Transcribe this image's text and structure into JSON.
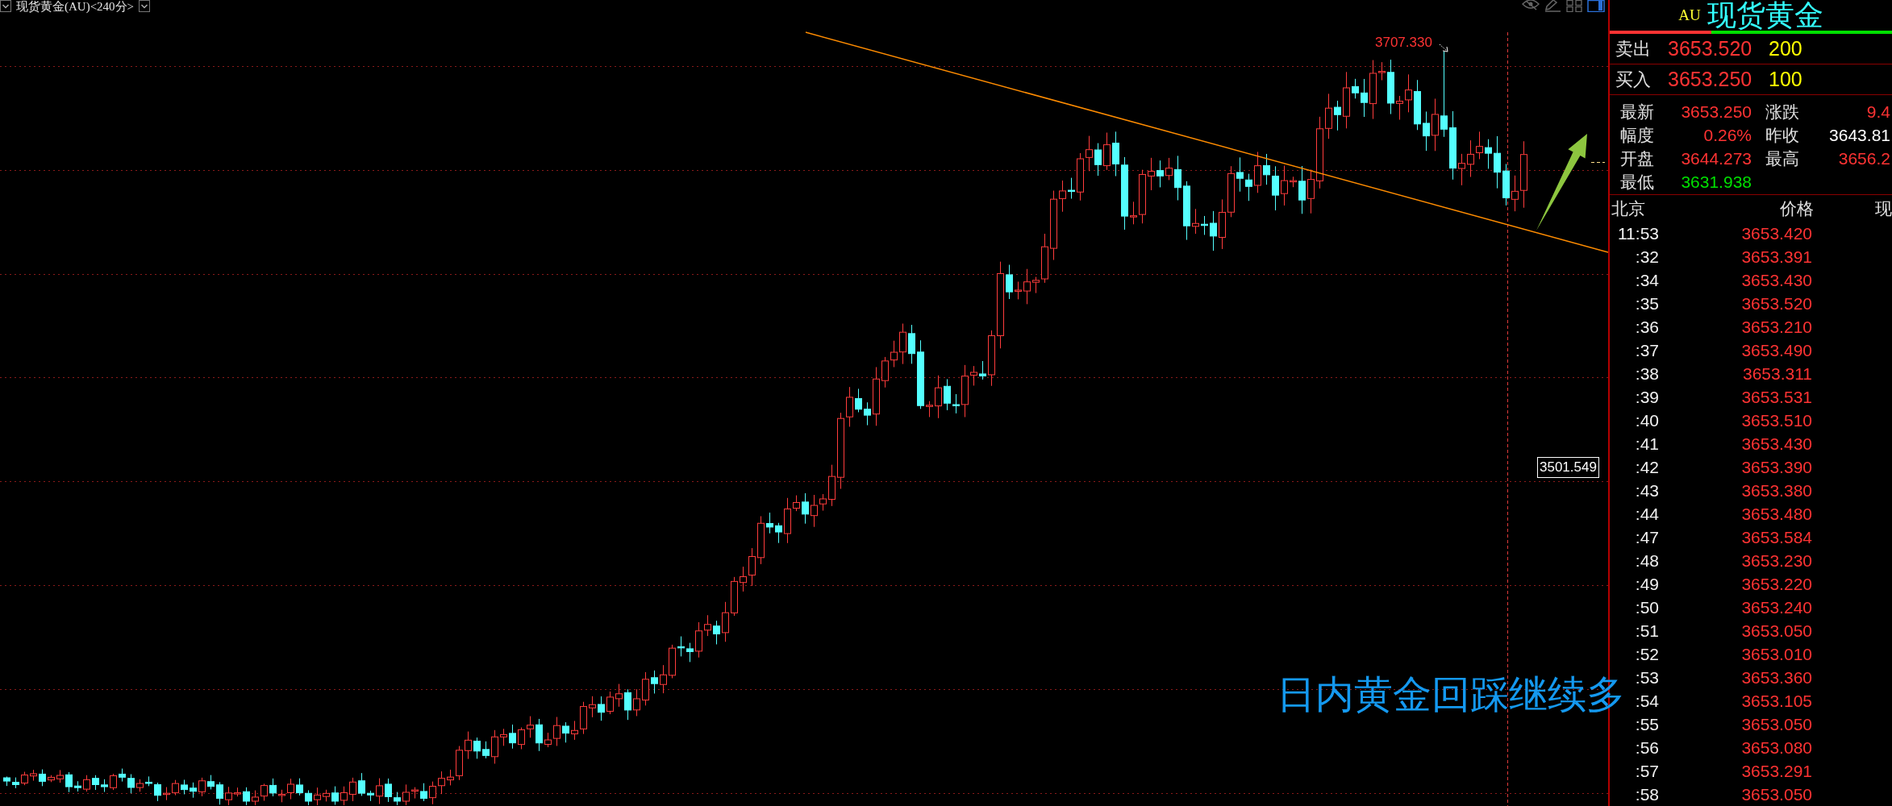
{
  "toolbar": {
    "title": "现货黄金(AU)<240分>"
  },
  "chart": {
    "high_label": "3707.330",
    "price_label": "3501.549",
    "annotation": "日内黄金回踩继续多"
  },
  "quote_panel": {
    "code": "AU",
    "name": "现货黄金",
    "buy_sell_bar": {
      "level": 0.36
    },
    "orders": [
      {
        "label": "卖出",
        "price": "3653.520",
        "volume": "200"
      },
      {
        "label": "买入",
        "price": "3653.250",
        "volume": "100"
      }
    ],
    "stats": [
      {
        "label": "最新",
        "value": "3653.250",
        "color": "#ff3333"
      },
      {
        "label": "涨跌",
        "value": "9.4",
        "color": "#ff3333"
      },
      {
        "label": "幅度",
        "value": "0.26%",
        "color": "#ff3333"
      },
      {
        "label": "昨收",
        "value": "3643.81",
        "color": "#ffffff"
      },
      {
        "label": "开盘",
        "value": "3644.273",
        "color": "#ff3333"
      },
      {
        "label": "最高",
        "value": "3656.2",
        "color": "#ff3333"
      },
      {
        "label": "最低",
        "value": "3631.938",
        "color": "#00e000"
      }
    ],
    "ticks": {
      "columns": [
        "北京",
        "价格",
        "现"
      ],
      "rows": [
        {
          "time": "11:53",
          "price": "3653.420"
        },
        {
          "time": ":32",
          "price": "3653.391"
        },
        {
          "time": ":34",
          "price": "3653.430"
        },
        {
          "time": ":35",
          "price": "3653.520"
        },
        {
          "time": ":36",
          "price": "3653.210"
        },
        {
          "time": ":37",
          "price": "3653.490"
        },
        {
          "time": ":38",
          "price": "3653.311"
        },
        {
          "time": ":39",
          "price": "3653.531"
        },
        {
          "time": ":40",
          "price": "3653.510"
        },
        {
          "time": ":41",
          "price": "3653.430"
        },
        {
          "time": ":42",
          "price": "3653.390"
        },
        {
          "time": ":43",
          "price": "3653.380"
        },
        {
          "time": ":44",
          "price": "3653.480"
        },
        {
          "time": ":47",
          "price": "3653.584"
        },
        {
          "time": ":48",
          "price": "3653.230"
        },
        {
          "time": ":49",
          "price": "3653.220"
        },
        {
          "time": ":50",
          "price": "3653.240"
        },
        {
          "time": ":51",
          "price": "3653.050"
        },
        {
          "time": ":52",
          "price": "3653.010"
        },
        {
          "time": ":53",
          "price": "3653.360"
        },
        {
          "time": ":54",
          "price": "3653.105"
        },
        {
          "time": ":55",
          "price": "3653.050"
        },
        {
          "time": ":56",
          "price": "3653.080"
        },
        {
          "time": ":57",
          "price": "3653.291"
        },
        {
          "time": ":58",
          "price": "3653.050"
        }
      ]
    }
  }
}
